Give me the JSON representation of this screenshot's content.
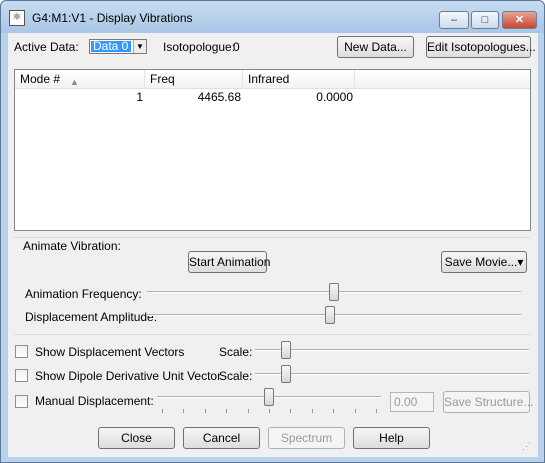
{
  "window": {
    "title": "G4:M1:V1 - Display Vibrations",
    "app_icon": "gaussview-app-icon",
    "minimize_glyph": "–",
    "maximize_glyph": "□",
    "close_glyph": "✕"
  },
  "top": {
    "active_data_label": "Active Data:",
    "active_data_value": "Data 0",
    "isotopologue_label": "Isotopologue:",
    "isotopologue_value": "0",
    "new_data_button": "New Data...",
    "edit_isotopologues_button": "Edit Isotopologues..."
  },
  "table": {
    "columns": [
      "Mode #",
      "Freq",
      "Infrared"
    ],
    "sort_glyph": "▲",
    "rows": [
      {
        "mode": "1",
        "freq": "4465.68",
        "infrared": "0.0000"
      }
    ]
  },
  "animate": {
    "group_label": "Animate Vibration:",
    "start_button": "Start Animation",
    "save_movie_button": "Save Movie...▾",
    "frequency_label": "Animation Frequency:",
    "frequency_level": 0.5,
    "amplitude_label": "Displacement Amplitude:",
    "amplitude_level": 0.49
  },
  "options": {
    "show_displacement_vectors": {
      "label": "Show Displacement Vectors",
      "checked": false,
      "scale_label": "Scale:",
      "scale_level": 0.1
    },
    "show_dipole_derivative": {
      "label": "Show Dipole Derivative Unit Vector",
      "checked": false,
      "scale_label": "Scale:",
      "scale_level": 0.1
    },
    "manual_displacement": {
      "label": "Manual Displacement:",
      "checked": false,
      "value": "0.00",
      "level": 0.5,
      "save_structure_button": "Save Structure..."
    }
  },
  "footer": {
    "close_button": "Close",
    "cancel_button": "Cancel",
    "spectrum_button": "Spectrum",
    "help_button": "Help",
    "grip_glyph": "⋰"
  },
  "colors": {
    "selection": "#3399ff",
    "window_frame": "#b9d1ea",
    "disabled_text": "#9a9a9a"
  }
}
